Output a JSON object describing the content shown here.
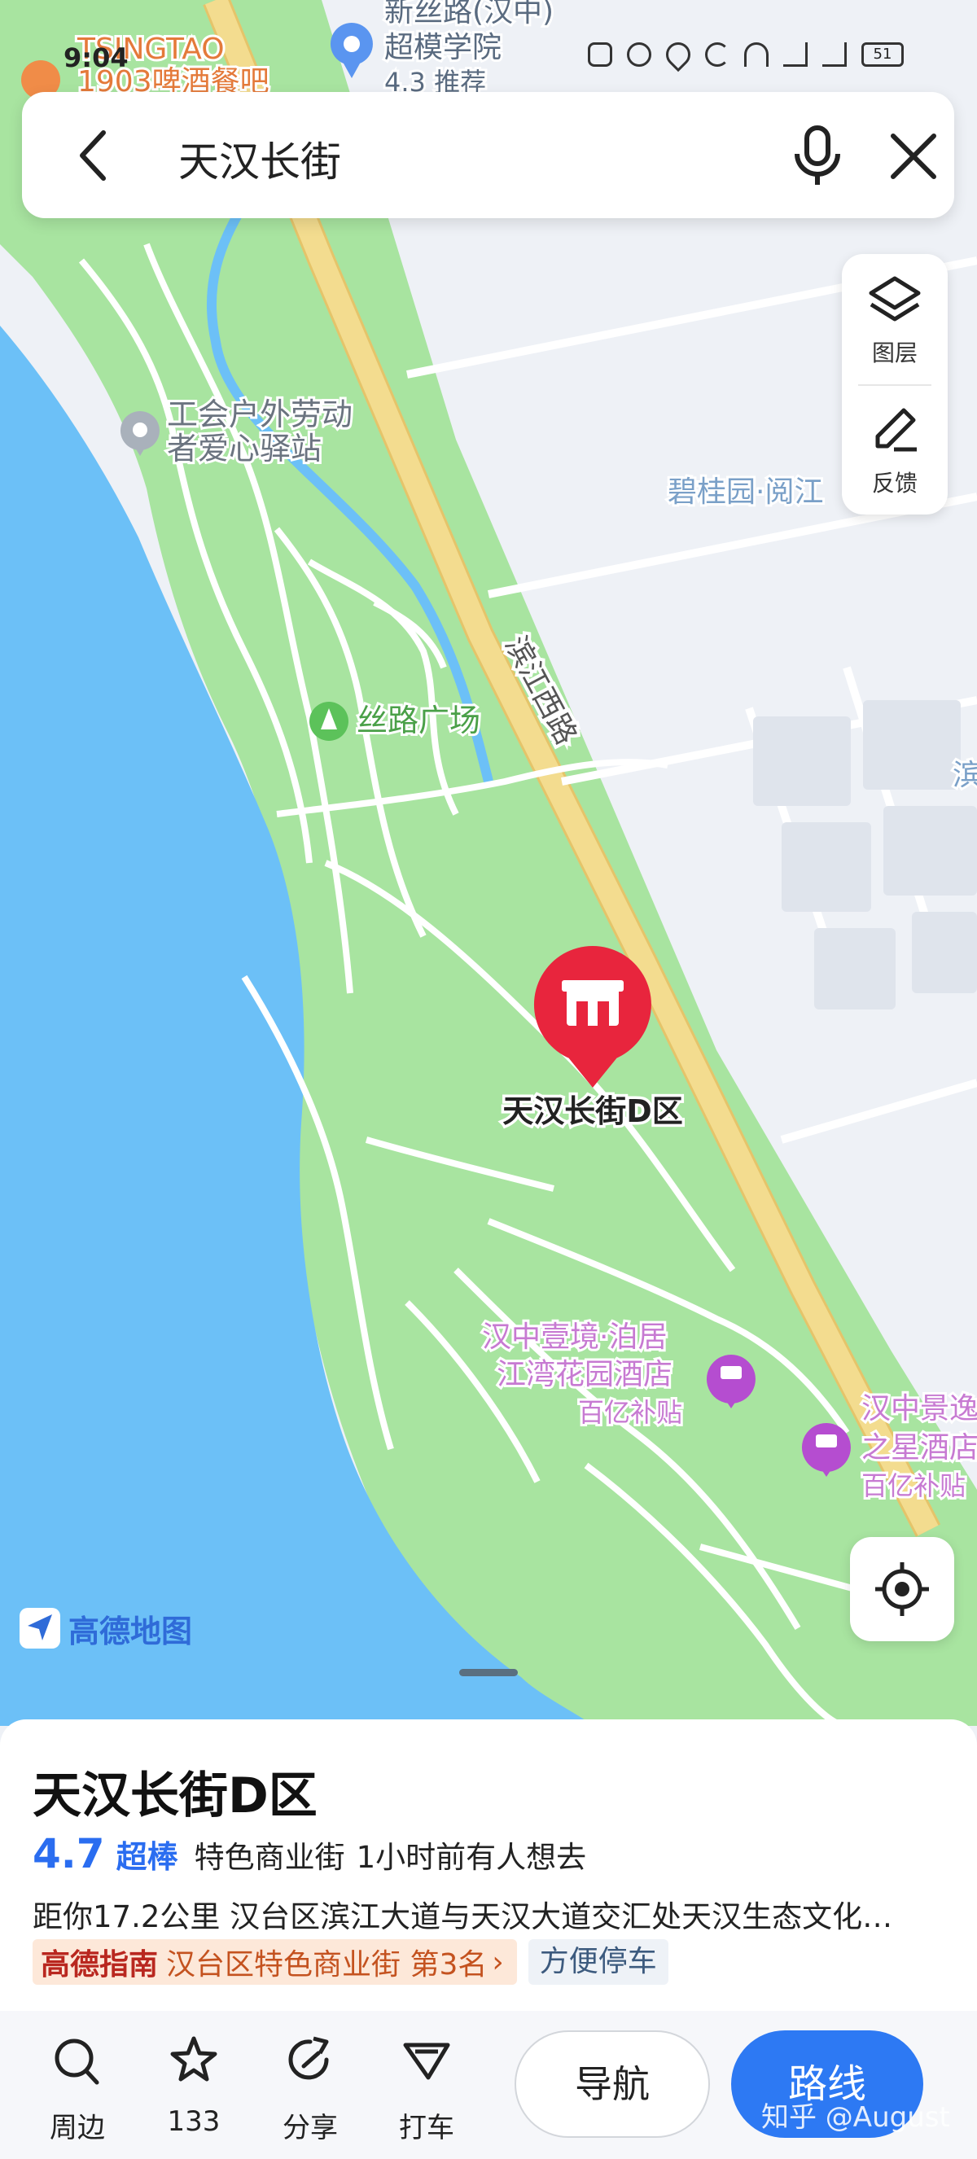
{
  "status_bar": {
    "time": "9:04",
    "battery": "51"
  },
  "search": {
    "query": "天汉长街"
  },
  "map": {
    "road_name": "滨江西路",
    "pois": [
      {
        "name_line1": "工会户外劳动",
        "name_line2": "者爱心驿站"
      },
      {
        "name_line1": "丝路广场"
      },
      {
        "name_line1": "碧桂园·阅江"
      },
      {
        "name_line1": "新丝路(汉中)",
        "name_line2": "超模学院",
        "name_line3": "4.3 推荐"
      },
      {
        "name_line1": "TSINGTAO",
        "name_line2": "1903啤酒餐吧"
      },
      {
        "name_line1": "汉中壹境·泊居",
        "name_line2": "江湾花园酒店",
        "name_line3": "百亿补贴"
      },
      {
        "name_line1": "汉中景逸",
        "name_line2": "之星酒店",
        "name_line3": "百亿补贴"
      },
      {
        "name_line1": "滨"
      }
    ],
    "selected_marker_label": "天汉长街D区",
    "colors": {
      "water": "#6cc0f7",
      "park": "#a8e4a0",
      "road": "#f3dc8f",
      "urban": "#eef1f6",
      "marker": "#e8253d"
    }
  },
  "controls": {
    "layers_label": "图层",
    "feedback_label": "反馈"
  },
  "brand": {
    "name": "高德地图"
  },
  "place": {
    "title": "天汉长街D区",
    "rating": "4.7",
    "rating_word": "超棒",
    "category": "特色商业街",
    "recent": "1小时前有人想去",
    "distance": "距你17.2公里",
    "address": "汉台区滨江大道与天汉大道交汇处天汉生态文化…",
    "guide_logo": "高德指南",
    "guide_rank": "汉台区特色商业街 第3名",
    "guide_arrow": "›",
    "feature_tag": "方便停车"
  },
  "toolbar": {
    "nearby": "周边",
    "favorites_count": "133",
    "share": "分享",
    "taxi": "打车",
    "navigate": "导航",
    "route": "路线"
  },
  "watermark": "知乎 @August"
}
